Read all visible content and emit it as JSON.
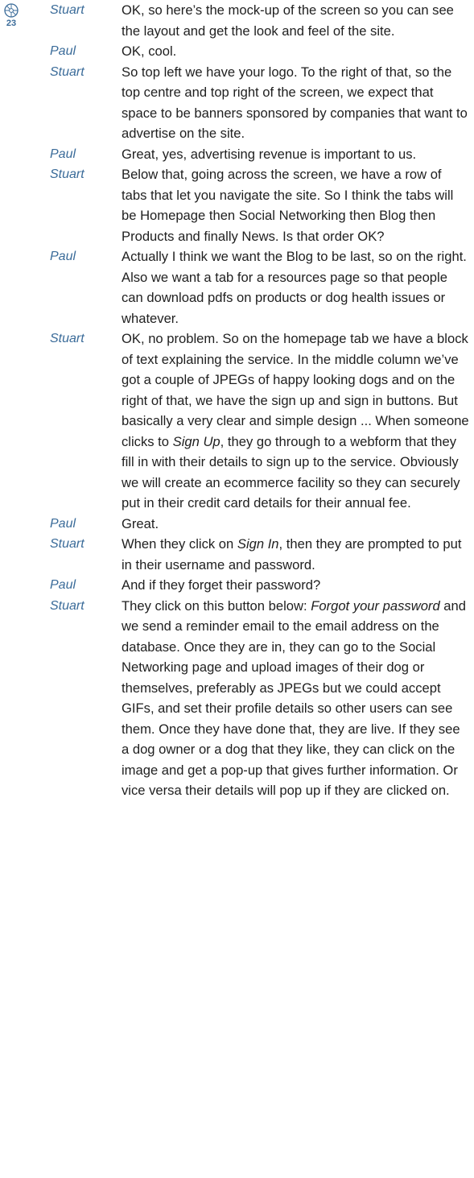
{
  "track": {
    "icon": "cd-icon",
    "number": "23",
    "color": "#3a6b99"
  },
  "transcript": [
    {
      "speaker": "Stuart",
      "parts": [
        {
          "text": "OK, so here’s the mock-up of the screen so you can see the layout and get the look and feel of the site."
        }
      ]
    },
    {
      "speaker": "Paul",
      "parts": [
        {
          "text": "OK, cool."
        }
      ]
    },
    {
      "speaker": "Stuart",
      "parts": [
        {
          "text": "So top left we have your logo. To the right of that, so the top centre and top right of the screen, we expect that space to be banners sponsored by companies that want to advertise on the site."
        }
      ]
    },
    {
      "speaker": "Paul",
      "parts": [
        {
          "text": "Great, yes, advertising revenue is important to us."
        }
      ]
    },
    {
      "speaker": "Stuart",
      "parts": [
        {
          "text": "Below that, going across the screen, we have a row of tabs that let you navigate the site. So I think the tabs will be Homepage then Social Networking then Blog then Products and finally News. Is that order OK?"
        }
      ]
    },
    {
      "speaker": "Paul",
      "parts": [
        {
          "text": "Actually I think we want the Blog to be last, so on the right. Also we want a tab for a resources page so that people can download pdfs on products or dog health issues or whatever."
        }
      ]
    },
    {
      "speaker": "Stuart",
      "parts": [
        {
          "text": "OK, no problem. So on the homepage tab we have a block of text explaining the service. In the middle column we’ve got a couple of JPEGs of happy looking dogs and on the right of that, we have the sign up and sign in buttons. But basically a very clear and simple design ... When someone clicks to "
        },
        {
          "text": "Sign Up",
          "italic": true
        },
        {
          "text": ", they go through to a webform that they fill in with their details to sign up to the service. Obviously we will create an ecommerce facility so they can securely put in their credit card details for their annual fee."
        }
      ]
    },
    {
      "speaker": "Paul",
      "parts": [
        {
          "text": "Great."
        }
      ]
    },
    {
      "speaker": "Stuart",
      "parts": [
        {
          "text": "When they click on "
        },
        {
          "text": "Sign In",
          "italic": true
        },
        {
          "text": ", then they are prompted to put in their username and password."
        }
      ]
    },
    {
      "speaker": "Paul",
      "parts": [
        {
          "text": "And if they forget their password?"
        }
      ]
    },
    {
      "speaker": "Stuart",
      "parts": [
        {
          "text": "They click on this button below: "
        },
        {
          "text": "Forgot your password",
          "italic": true
        },
        {
          "text": " and we send a reminder email to the email address on the database. Once they are in, they can go to the Social Networking page and upload images of their dog or themselves, preferably as JPEGs but we could accept GIFs, and set their profile details so other users can see them. Once they have done that, they are live. If they see a dog owner or a dog that they like, they can click on the image and get a pop-up that gives further information. Or vice versa their details will pop up if they are clicked on."
        }
      ]
    }
  ]
}
